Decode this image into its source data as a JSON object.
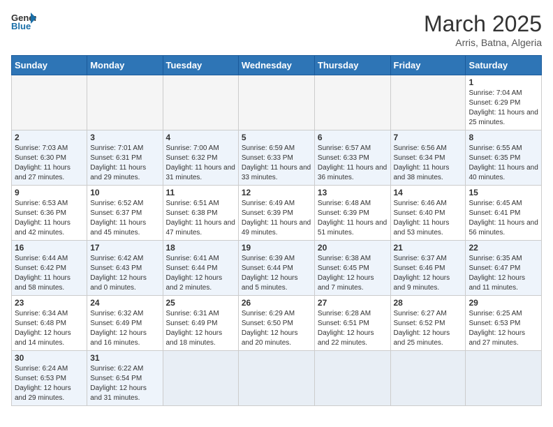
{
  "header": {
    "logo_general": "General",
    "logo_blue": "Blue",
    "month_year": "March 2025",
    "location": "Arris, Batna, Algeria"
  },
  "weekdays": [
    "Sunday",
    "Monday",
    "Tuesday",
    "Wednesday",
    "Thursday",
    "Friday",
    "Saturday"
  ],
  "weeks": [
    [
      {
        "day": "",
        "info": ""
      },
      {
        "day": "",
        "info": ""
      },
      {
        "day": "",
        "info": ""
      },
      {
        "day": "",
        "info": ""
      },
      {
        "day": "",
        "info": ""
      },
      {
        "day": "",
        "info": ""
      },
      {
        "day": "1",
        "info": "Sunrise: 7:04 AM\nSunset: 6:29 PM\nDaylight: 11 hours and 25 minutes."
      }
    ],
    [
      {
        "day": "2",
        "info": "Sunrise: 7:03 AM\nSunset: 6:30 PM\nDaylight: 11 hours and 27 minutes."
      },
      {
        "day": "3",
        "info": "Sunrise: 7:01 AM\nSunset: 6:31 PM\nDaylight: 11 hours and 29 minutes."
      },
      {
        "day": "4",
        "info": "Sunrise: 7:00 AM\nSunset: 6:32 PM\nDaylight: 11 hours and 31 minutes."
      },
      {
        "day": "5",
        "info": "Sunrise: 6:59 AM\nSunset: 6:33 PM\nDaylight: 11 hours and 33 minutes."
      },
      {
        "day": "6",
        "info": "Sunrise: 6:57 AM\nSunset: 6:33 PM\nDaylight: 11 hours and 36 minutes."
      },
      {
        "day": "7",
        "info": "Sunrise: 6:56 AM\nSunset: 6:34 PM\nDaylight: 11 hours and 38 minutes."
      },
      {
        "day": "8",
        "info": "Sunrise: 6:55 AM\nSunset: 6:35 PM\nDaylight: 11 hours and 40 minutes."
      }
    ],
    [
      {
        "day": "9",
        "info": "Sunrise: 6:53 AM\nSunset: 6:36 PM\nDaylight: 11 hours and 42 minutes."
      },
      {
        "day": "10",
        "info": "Sunrise: 6:52 AM\nSunset: 6:37 PM\nDaylight: 11 hours and 45 minutes."
      },
      {
        "day": "11",
        "info": "Sunrise: 6:51 AM\nSunset: 6:38 PM\nDaylight: 11 hours and 47 minutes."
      },
      {
        "day": "12",
        "info": "Sunrise: 6:49 AM\nSunset: 6:39 PM\nDaylight: 11 hours and 49 minutes."
      },
      {
        "day": "13",
        "info": "Sunrise: 6:48 AM\nSunset: 6:39 PM\nDaylight: 11 hours and 51 minutes."
      },
      {
        "day": "14",
        "info": "Sunrise: 6:46 AM\nSunset: 6:40 PM\nDaylight: 11 hours and 53 minutes."
      },
      {
        "day": "15",
        "info": "Sunrise: 6:45 AM\nSunset: 6:41 PM\nDaylight: 11 hours and 56 minutes."
      }
    ],
    [
      {
        "day": "16",
        "info": "Sunrise: 6:44 AM\nSunset: 6:42 PM\nDaylight: 11 hours and 58 minutes."
      },
      {
        "day": "17",
        "info": "Sunrise: 6:42 AM\nSunset: 6:43 PM\nDaylight: 12 hours and 0 minutes."
      },
      {
        "day": "18",
        "info": "Sunrise: 6:41 AM\nSunset: 6:44 PM\nDaylight: 12 hours and 2 minutes."
      },
      {
        "day": "19",
        "info": "Sunrise: 6:39 AM\nSunset: 6:44 PM\nDaylight: 12 hours and 5 minutes."
      },
      {
        "day": "20",
        "info": "Sunrise: 6:38 AM\nSunset: 6:45 PM\nDaylight: 12 hours and 7 minutes."
      },
      {
        "day": "21",
        "info": "Sunrise: 6:37 AM\nSunset: 6:46 PM\nDaylight: 12 hours and 9 minutes."
      },
      {
        "day": "22",
        "info": "Sunrise: 6:35 AM\nSunset: 6:47 PM\nDaylight: 12 hours and 11 minutes."
      }
    ],
    [
      {
        "day": "23",
        "info": "Sunrise: 6:34 AM\nSunset: 6:48 PM\nDaylight: 12 hours and 14 minutes."
      },
      {
        "day": "24",
        "info": "Sunrise: 6:32 AM\nSunset: 6:49 PM\nDaylight: 12 hours and 16 minutes."
      },
      {
        "day": "25",
        "info": "Sunrise: 6:31 AM\nSunset: 6:49 PM\nDaylight: 12 hours and 18 minutes."
      },
      {
        "day": "26",
        "info": "Sunrise: 6:29 AM\nSunset: 6:50 PM\nDaylight: 12 hours and 20 minutes."
      },
      {
        "day": "27",
        "info": "Sunrise: 6:28 AM\nSunset: 6:51 PM\nDaylight: 12 hours and 22 minutes."
      },
      {
        "day": "28",
        "info": "Sunrise: 6:27 AM\nSunset: 6:52 PM\nDaylight: 12 hours and 25 minutes."
      },
      {
        "day": "29",
        "info": "Sunrise: 6:25 AM\nSunset: 6:53 PM\nDaylight: 12 hours and 27 minutes."
      }
    ],
    [
      {
        "day": "30",
        "info": "Sunrise: 6:24 AM\nSunset: 6:53 PM\nDaylight: 12 hours and 29 minutes."
      },
      {
        "day": "31",
        "info": "Sunrise: 6:22 AM\nSunset: 6:54 PM\nDaylight: 12 hours and 31 minutes."
      },
      {
        "day": "",
        "info": ""
      },
      {
        "day": "",
        "info": ""
      },
      {
        "day": "",
        "info": ""
      },
      {
        "day": "",
        "info": ""
      },
      {
        "day": "",
        "info": ""
      }
    ]
  ]
}
